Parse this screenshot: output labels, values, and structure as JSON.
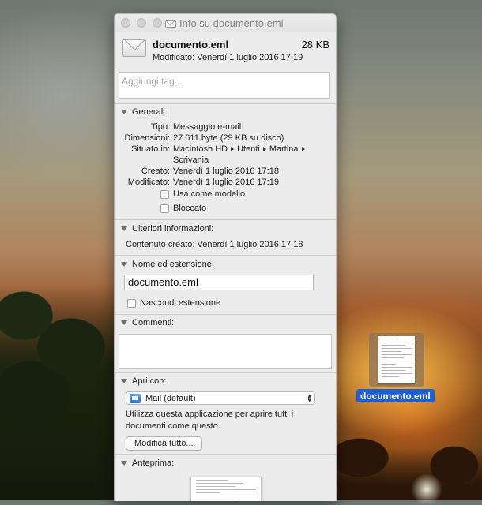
{
  "window": {
    "title": "Info su documento.eml",
    "file_name": "documento.eml",
    "file_size": "28 KB",
    "modified_line": "Modificato:  Venerdì 1 luglio 2016 17:19",
    "tags_placeholder": "Aggiungi tag..."
  },
  "general": {
    "title": "Generali:",
    "tipo_label": "Tipo:",
    "tipo_value": "Messaggio e-mail",
    "dim_label": "Dimensioni:",
    "dim_value": "27.611 byte (29 KB su disco)",
    "situato_label": "Situato in:",
    "path": [
      "Macintosh HD",
      "Utenti",
      "Martina"
    ],
    "path_last": "Scrivania",
    "creato_label": "Creato:",
    "creato_value": "Venerdì 1 luglio 2016 17:18",
    "modificato_label": "Modificato:",
    "modificato_value": "Venerdì 1 luglio 2016 17:19",
    "stationery_label": "Usa come modello",
    "locked_label": "Bloccato"
  },
  "more_info": {
    "title": "Ulteriori informazioni:",
    "content_created": "Contenuto creato:  Venerdì 1 luglio 2016 17:18"
  },
  "name_ext": {
    "title": "Nome ed estensione:",
    "value": "documento.eml",
    "hide_ext_label": "Nascondi estensione"
  },
  "comments": {
    "title": "Commenti:"
  },
  "open_with": {
    "title": "Apri con:",
    "selected_app": "Mail (default)",
    "description": "Utilizza questa applicazione per aprire tutti i documenti come questo.",
    "change_all_button": "Modifica tutto..."
  },
  "preview": {
    "title": "Anteprima:"
  },
  "desktop": {
    "icon_label": "documento.eml"
  }
}
